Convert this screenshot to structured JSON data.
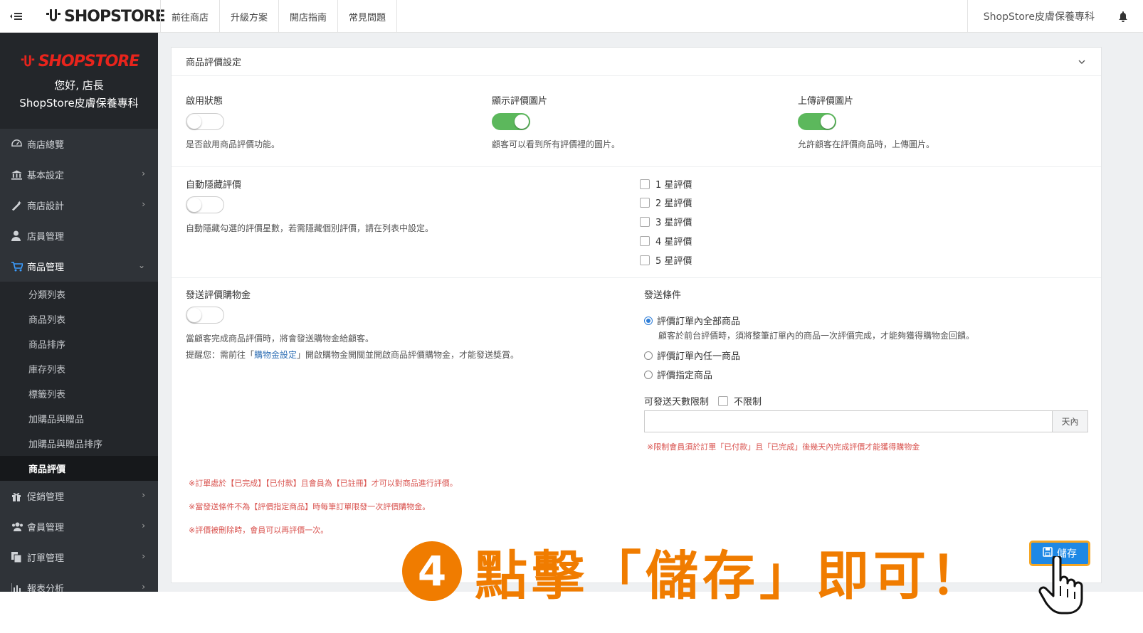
{
  "topbar": {
    "brand": "SHOPSTORE",
    "nav": [
      "前往商店",
      "升級方案",
      "開店指南",
      "常見問題"
    ],
    "store_name": "ShopStore皮膚保養專科",
    "icons": {
      "toggle": "menu-collapse-icon",
      "bell": "bell-icon"
    }
  },
  "sidebar": {
    "brand": "SHOPSTORE",
    "greeting": "您好, 店長",
    "store_name": "ShopStore皮膚保養專科",
    "items": [
      {
        "label": "商店總覽",
        "icon": "dashboard-icon"
      },
      {
        "label": "基本設定",
        "icon": "bank-icon"
      },
      {
        "label": "商店設計",
        "icon": "magic-wand-icon"
      },
      {
        "label": "店員管理",
        "icon": "staff-icon"
      },
      {
        "label": "商品管理",
        "icon": "cart-icon"
      },
      {
        "label": "促銷管理",
        "icon": "gift-icon"
      },
      {
        "label": "會員管理",
        "icon": "users-icon"
      },
      {
        "label": "訂單管理",
        "icon": "copy-icon"
      },
      {
        "label": "報表分析",
        "icon": "bar-chart-icon"
      }
    ],
    "sub_items": [
      "分類列表",
      "商品列表",
      "商品排序",
      "庫存列表",
      "標籤列表",
      "加購品與贈品",
      "加購品與贈品排序",
      "商品評價"
    ]
  },
  "card": {
    "title": "商品評價設定",
    "enable": {
      "label": "啟用狀態",
      "help": "是否啟用商品評價功能。",
      "on": false
    },
    "show_images": {
      "label": "顯示評價圖片",
      "help": "顧客可以看到所有評價裡的圖片。",
      "on": true
    },
    "upload_images": {
      "label": "上傳評價圖片",
      "help": "允許顧客在評價商品時，上傳圖片。",
      "on": true
    },
    "auto_hide": {
      "label": "自動隱藏評價",
      "help": "自動隱藏勾選的評價星數，若需隱藏個別評價，請在列表中設定。",
      "on": false,
      "stars": [
        "1 星評價",
        "2 星評價",
        "3 星評價",
        "4 星評價",
        "5 星評價"
      ]
    },
    "reward": {
      "label": "發送評價購物金",
      "on": false,
      "help1": "當顧客完成商品評價時，將會發送購物金給顧客。",
      "help2_pre": "提醒您：需前往「",
      "help2_link": "購物金設定",
      "help2_post": "」開啟購物金開關並開啟商品評價購物金，才能發送獎賞。"
    },
    "condition": {
      "label": "發送條件",
      "options": [
        "評價訂單內全部商品",
        "評價訂單內任一商品",
        "評價指定商品"
      ],
      "selected": "評價訂單內全部商品",
      "option1_desc": "顧客於前台評價時，須將整筆訂單內的商品一次評價完成，才能夠獲得購物金回饋。",
      "days_label": "可發送天數限制",
      "unlimited_label": "不限制",
      "days_value": "",
      "days_suffix": "天內",
      "days_note": "※限制會員須於訂單「已付款」且「已完成」後幾天內完成評價才能獲得購物金"
    },
    "notes": [
      "※訂單處於【已完成】【已付款】且會員為【已註冊】才可以對商品進行評價。",
      "※當發送條件不為【評價指定商品】時每筆訂單限發一次評價購物金。",
      "※評價被刪除時，會員可以再評價一次。"
    ],
    "save_label": "儲存"
  },
  "callout": {
    "number": "4",
    "text": "點擊「儲存」即可！"
  },
  "colors": {
    "accent": "#f07c00",
    "primary": "#1e88e5",
    "toggle_on": "#5cb85c",
    "sidebar": "#2f3338",
    "brand_red": "#e8241c"
  }
}
